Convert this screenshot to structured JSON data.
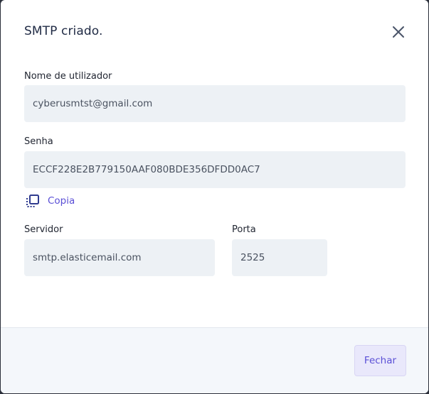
{
  "modal": {
    "title": "SMTP criado.",
    "close_icon": "close-icon"
  },
  "form": {
    "username_label": "Nome de utilizador",
    "username_value": "cyberusmtst@gmail.com",
    "password_label": "Senha",
    "password_value": "ECCF228E2B779150AAF080BDE356DFDD0AC7",
    "copy_label": "Copia",
    "copy_icon": "copy-icon",
    "server_label": "Servidor",
    "server_value": "smtp.elasticemail.com",
    "port_label": "Porta",
    "port_value": "2525"
  },
  "footer": {
    "close_button_label": "Fechar"
  },
  "colors": {
    "accent": "#5a4fd6",
    "field_bg": "#edf1f5",
    "footer_bg": "#f4f7fb",
    "title": "#1f2a44"
  }
}
